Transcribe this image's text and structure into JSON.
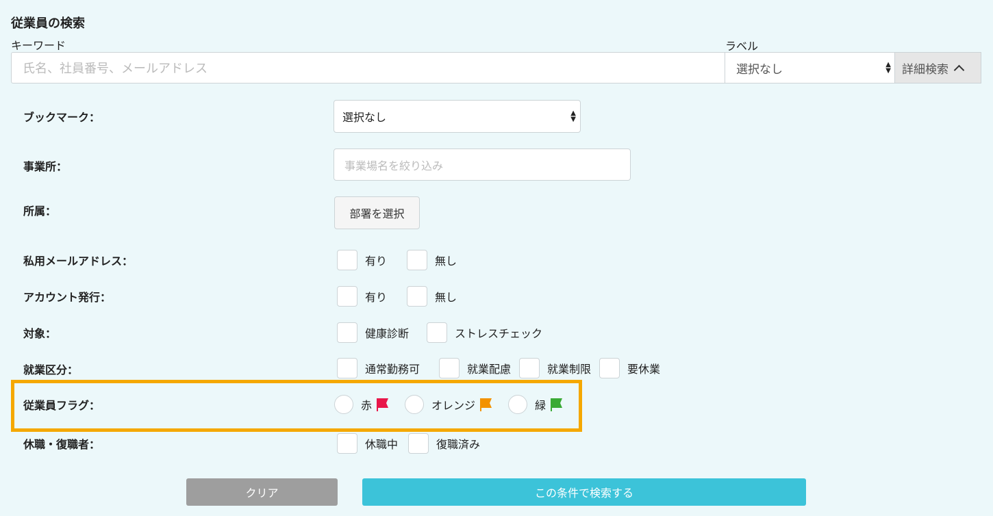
{
  "header": {
    "title": "従業員の検索"
  },
  "keyword": {
    "label": "キーワード",
    "placeholder": "氏名、社員番号、メールアドレス"
  },
  "label_filter": {
    "label": "ラベル",
    "value": "選択なし"
  },
  "detail_search": {
    "label": "詳細検索"
  },
  "bookmark": {
    "label": "ブックマーク：",
    "value": "選択なし"
  },
  "office": {
    "label": "事業所：",
    "placeholder": "事業場名を絞り込み"
  },
  "affiliation": {
    "label": "所属：",
    "button": "部署を選択"
  },
  "private_email": {
    "label": "私用メールアドレス：",
    "options": [
      "有り",
      "無し"
    ]
  },
  "account_issued": {
    "label": "アカウント発行：",
    "options": [
      "有り",
      "無し"
    ]
  },
  "target": {
    "label": "対象：",
    "options": [
      "健康診断",
      "ストレスチェック"
    ]
  },
  "work_category": {
    "label": "就業区分：",
    "options": [
      "通常勤務可",
      "就業配慮",
      "就業制限",
      "要休業"
    ]
  },
  "employee_flag": {
    "label": "従業員フラグ：",
    "options": [
      {
        "label": "赤",
        "icon": "red-flag-icon",
        "color": "#e8174a"
      },
      {
        "label": "オレンジ",
        "icon": "orange-flag-icon",
        "color": "#f39200"
      },
      {
        "label": "緑",
        "icon": "green-flag-icon",
        "color": "#3aaa35"
      }
    ]
  },
  "leave": {
    "label": "休職・復職者：",
    "options": [
      "休職中",
      "復職済み"
    ]
  },
  "actions": {
    "clear": "クリア",
    "search": "この条件で検索する"
  },
  "colors": {
    "highlight": "#f5a800",
    "primary": "#3cc3d9",
    "background": "#ecf8fa"
  }
}
